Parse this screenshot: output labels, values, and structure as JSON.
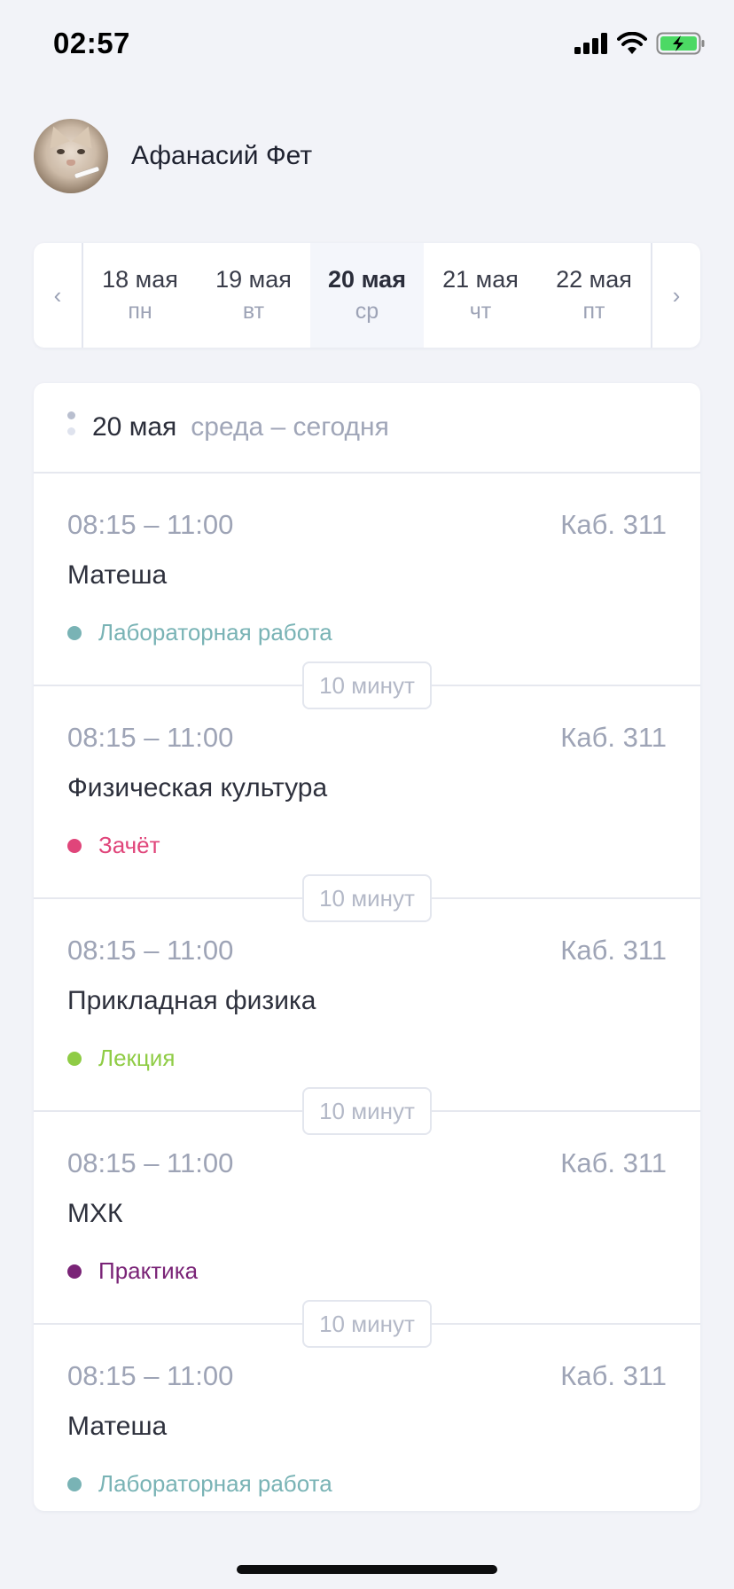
{
  "status": {
    "time": "02:57"
  },
  "profile": {
    "name": "Афанасий Фет"
  },
  "week": {
    "days": [
      {
        "date": "18 мая",
        "weekday": "пн",
        "selected": false
      },
      {
        "date": "19 мая",
        "weekday": "вт",
        "selected": false
      },
      {
        "date": "20 мая",
        "weekday": "ср",
        "selected": true
      },
      {
        "date": "21 мая",
        "weekday": "чт",
        "selected": false
      },
      {
        "date": "22 мая",
        "weekday": "пт",
        "selected": false
      }
    ],
    "prev_glyph": "‹",
    "next_glyph": "›"
  },
  "schedule": {
    "date": "20 мая",
    "subtitle": "среда – сегодня",
    "lessons": [
      {
        "time": "08:15 – 11:00",
        "room": "Каб. 311",
        "name": "Матеша",
        "type": "Лабораторная работа",
        "type_color": "#79b3b5",
        "break": "10 минут"
      },
      {
        "time": "08:15 – 11:00",
        "room": "Каб. 311",
        "name": "Физическая культура",
        "type": "Зачёт",
        "type_color": "#e0457a",
        "break": "10 минут"
      },
      {
        "time": "08:15 – 11:00",
        "room": "Каб. 311",
        "name": "Прикладная физика",
        "type": "Лекция",
        "type_color": "#8fcc45",
        "break": "10 минут"
      },
      {
        "time": "08:15 – 11:00",
        "room": "Каб. 311",
        "name": "МХК",
        "type": "Практика",
        "type_color": "#7a2477",
        "break": "10 минут"
      },
      {
        "time": "08:15 – 11:00",
        "room": "Каб. 311",
        "name": "Матеша",
        "type": "Лабораторная работа",
        "type_color": "#79b3b5"
      }
    ]
  }
}
